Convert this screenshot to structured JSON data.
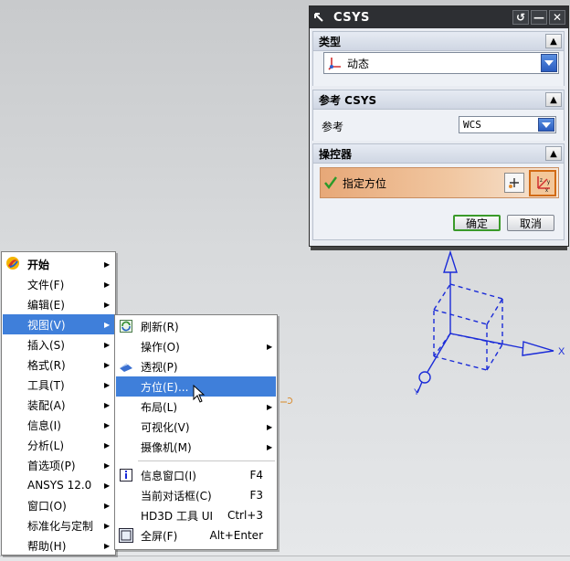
{
  "dialog": {
    "title": "CSYS",
    "title_buttons": {
      "reset": "↺",
      "minimize": "—",
      "close": "✕"
    },
    "sections": {
      "type": {
        "header": "类型",
        "selected": "动态"
      },
      "reference": {
        "header": "参考 CSYS",
        "label": "参考",
        "selected": "WCS"
      },
      "manipulator": {
        "header": "操控器",
        "action": "指定方位"
      }
    },
    "ok_label": "确定",
    "cancel_label": "取消"
  },
  "main_menu": {
    "items": [
      {
        "label": "开始",
        "arrow": true,
        "bold": true
      },
      {
        "label": "文件(F)",
        "arrow": true
      },
      {
        "label": "编辑(E)",
        "arrow": true
      },
      {
        "label": "视图(V)",
        "arrow": true,
        "selected": true
      },
      {
        "label": "插入(S)",
        "arrow": true
      },
      {
        "label": "格式(R)",
        "arrow": true
      },
      {
        "label": "工具(T)",
        "arrow": true
      },
      {
        "label": "装配(A)",
        "arrow": true
      },
      {
        "label": "信息(I)",
        "arrow": true
      },
      {
        "label": "分析(L)",
        "arrow": true
      },
      {
        "label": "首选项(P)",
        "arrow": true
      },
      {
        "label": "ANSYS 12.0",
        "arrow": true
      },
      {
        "label": "窗口(O)",
        "arrow": true
      },
      {
        "label": "标准化与定制",
        "arrow": true
      },
      {
        "label": "帮助(H)",
        "arrow": true
      }
    ]
  },
  "view_submenu": {
    "items": [
      {
        "label": "刷新(R)",
        "icon": "refresh-icon"
      },
      {
        "label": "操作(O)",
        "arrow": true
      },
      {
        "label": "透视(P)",
        "icon": "perspective-icon"
      },
      {
        "label": "方位(E)...",
        "selected": true
      },
      {
        "label": "布局(L)",
        "arrow": true
      },
      {
        "label": "可视化(V)",
        "arrow": true
      },
      {
        "label": "摄像机(M)",
        "arrow": true
      },
      {
        "label": "信息窗口(I)",
        "shortcut": "F4",
        "icon": "info-icon"
      },
      {
        "label": "当前对话框(C)",
        "shortcut": "F3"
      },
      {
        "label": "HD3D 工具 UI",
        "shortcut": "Ctrl+3"
      },
      {
        "label": "全屏(F)",
        "shortcut": "Alt+Enter",
        "icon": "fullscreen-icon"
      }
    ]
  },
  "triad": {
    "x_label": "X"
  },
  "colors": {
    "menu_highlight": "#3f7fda",
    "dialog_title": "#2d2f33",
    "triad": "#1a2bd8",
    "orient_row": "#e7a878"
  }
}
